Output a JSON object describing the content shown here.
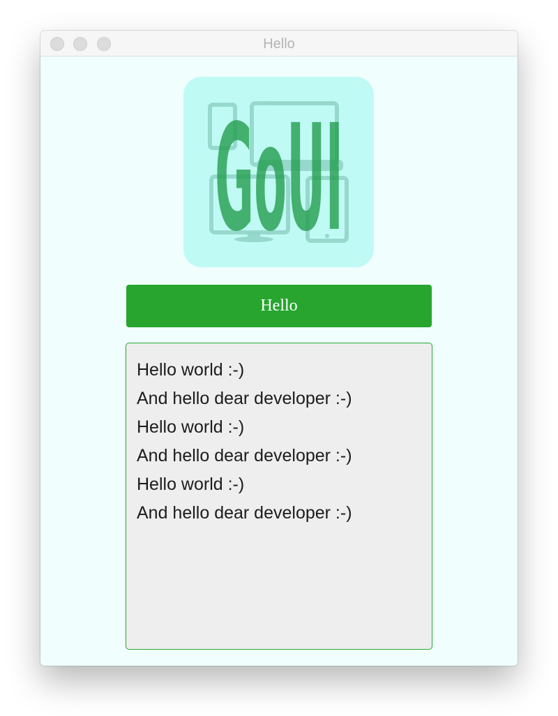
{
  "window": {
    "title": "Hello"
  },
  "logo": {
    "text": "GoUI",
    "icon": "devices-icon"
  },
  "main": {
    "hello_button_label": "Hello",
    "output_lines": [
      "Hello world :-)",
      "And hello dear developer :-)",
      "Hello world :-)",
      "And hello dear developer :-)",
      "Hello world :-)",
      "And hello dear developer :-)"
    ]
  },
  "colors": {
    "window_background": "#f0fffe",
    "logo_tile": "#c0faf5",
    "accent_green": "#27a52f",
    "output_background": "#eeeeee"
  }
}
